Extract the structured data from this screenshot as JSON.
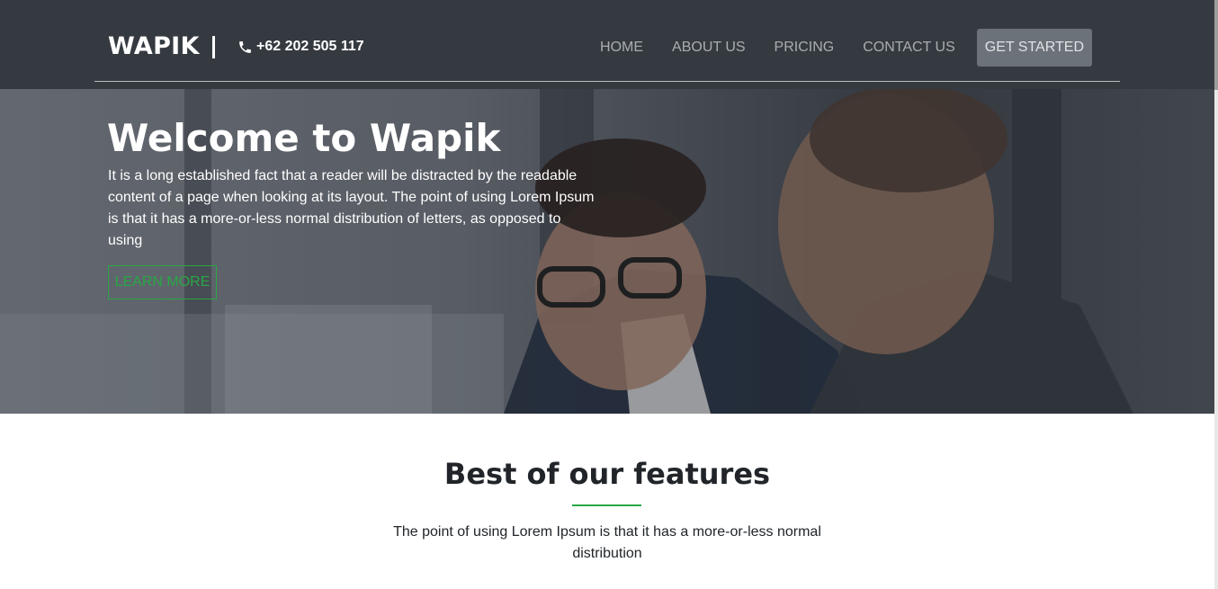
{
  "header": {
    "brand": "WAPIK",
    "phone": "+62 202 505 117",
    "nav": [
      {
        "label": "HOME"
      },
      {
        "label": "ABOUT US"
      },
      {
        "label": "PRICING"
      },
      {
        "label": "CONTACT US"
      }
    ],
    "cta_label": "GET STARTED"
  },
  "hero": {
    "title": "Welcome to Wapik",
    "text": "It is a long established fact that a reader will be distracted by the readable content of a page when looking at its layout. The point of using Lorem Ipsum is that it has a more-or-less normal distribution of letters, as opposed to using",
    "button_label": "LEARN MORE"
  },
  "features": {
    "title": "Best of our features",
    "text": "The point of using Lorem Ipsum is that it has a more-or-less normal distribution"
  },
  "colors": {
    "header_bg": "#343a40",
    "accent": "#28a745",
    "cta_bg": "#6c727a"
  },
  "icons": {
    "phone": "phone-icon"
  }
}
